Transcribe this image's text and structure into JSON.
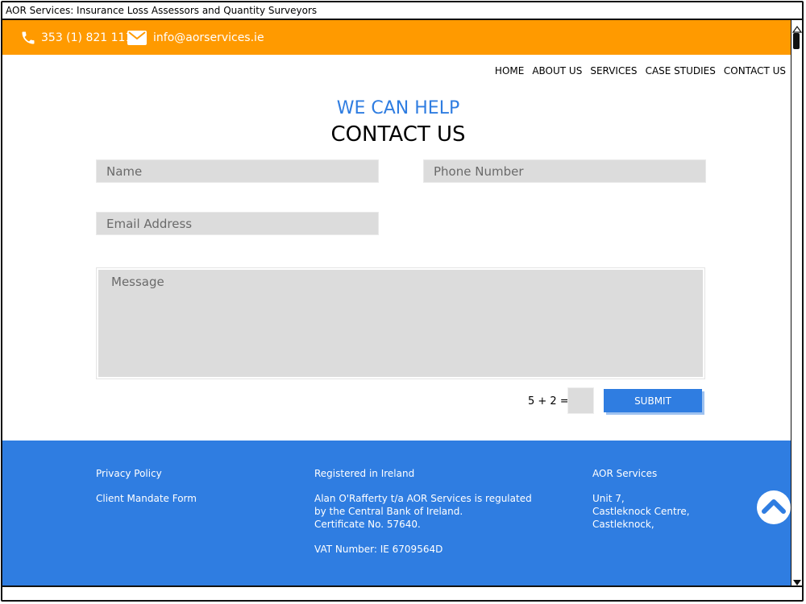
{
  "window": {
    "title": "AOR Services: Insurance Loss Assessors and Quantity Surveyors"
  },
  "topbar": {
    "phone": "353 (1) 821 1111",
    "email": "info@aorservices.ie",
    "color": "#ff9a00"
  },
  "nav": {
    "items": [
      "HOME",
      "ABOUT US",
      "SERVICES",
      "CASE STUDIES",
      "CONTACT US"
    ]
  },
  "hero": {
    "subtitle": "WE CAN HELP",
    "title": "CONTACT US",
    "accent": "#2f7de1"
  },
  "form": {
    "name_placeholder": "Name",
    "phone_placeholder": "Phone Number",
    "email_placeholder": "Email Address",
    "message_placeholder": "Message",
    "captcha_label": "5 + 2 =",
    "submit_label": "SUBMIT"
  },
  "footer": {
    "links": [
      "Privacy Policy",
      "Client Mandate Form"
    ],
    "registered_heading": "Registered in Ireland",
    "regulation_lines": [
      "Alan O'Rafferty t/a AOR Services is regulated",
      "by the Central Bank of Ireland.",
      "Certificate No. 57640."
    ],
    "vat": "VAT Number: IE 6709564D",
    "company_heading": "AOR Services",
    "address_lines": [
      "Unit 7,",
      "Castleknock Centre,",
      "Castleknock,"
    ],
    "color": "#2f7de1"
  },
  "icons": {
    "phone": "phone-icon",
    "email": "envelope-icon",
    "back_to_top": "chevron-up-icon"
  }
}
